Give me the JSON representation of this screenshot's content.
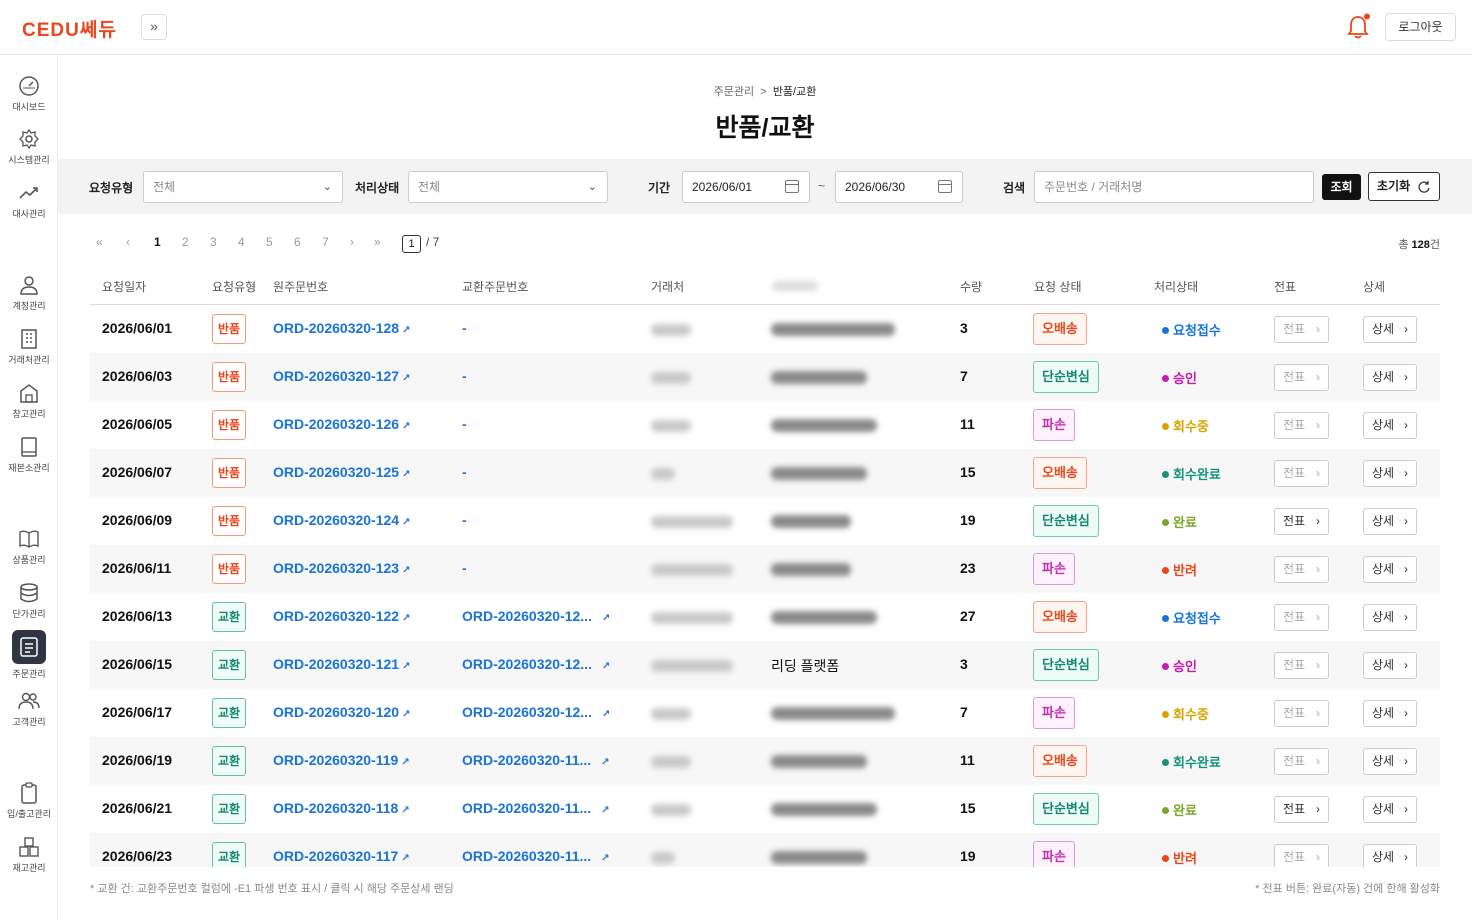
{
  "app": {
    "logo": "CEDU쎄듀",
    "expand_icon": "»",
    "logout_label": "로그아웃"
  },
  "sidebar": {
    "items": [
      {
        "label": "대시보드",
        "icon": "dashboard-icon"
      },
      {
        "label": "시스템관리",
        "icon": "gear-icon"
      },
      {
        "label": "대사관리",
        "icon": "trend-icon"
      },
      {
        "label": "계정관리",
        "icon": "user-icon"
      },
      {
        "label": "거래처관리",
        "icon": "building-icon"
      },
      {
        "label": "창고관리",
        "icon": "warehouse-icon"
      },
      {
        "label": "재본소관리",
        "icon": "book-closed-icon"
      },
      {
        "label": "상품관리",
        "icon": "book-open-icon"
      },
      {
        "label": "단가관리",
        "icon": "database-icon"
      },
      {
        "label": "주문관리",
        "icon": "order-list-icon",
        "active": true
      },
      {
        "label": "고객관리",
        "icon": "users-icon"
      },
      {
        "label": "입/출고관리",
        "icon": "clipboard-icon"
      },
      {
        "label": "재고관리",
        "icon": "boxes-icon"
      }
    ]
  },
  "breadcrumb": {
    "parent": "주문관리",
    "separator": ">",
    "current": "반품/교환"
  },
  "page_title": "반품/교환",
  "filters": {
    "request_type_label": "요청유형",
    "request_type_value": "전체",
    "process_status_label": "처리상태",
    "process_status_value": "전체",
    "period_label": "기간",
    "date_from": "2026/06/01",
    "tilde": "~",
    "date_to": "2026/06/30",
    "search_label": "검색",
    "search_placeholder": "주문번호 / 거래처명",
    "search_button": "조회",
    "reset_button": "초기화"
  },
  "pagination": {
    "first": "«",
    "prev": "‹",
    "pages": [
      "1",
      "2",
      "3",
      "4",
      "5",
      "6",
      "7"
    ],
    "next": "›",
    "last": "»",
    "current_input": "1",
    "total_pages": "/ 7"
  },
  "total": {
    "prefix": "총",
    "count": "128",
    "suffix": "건"
  },
  "columns": [
    "요청일자",
    "요청유형",
    "원주문번호",
    "교환주문번호",
    "거래처",
    "수량",
    "요청 상태",
    "처리상태",
    "전표",
    "상세"
  ],
  "rows": [
    {
      "date": "2026/06/01",
      "type": "반품",
      "order": "ORD-20260320-128",
      "exchange_order": "-",
      "product": "",
      "qty": "3",
      "request_status": "오배송",
      "process_status": "요청접수",
      "slip": "전표",
      "detail": "상세"
    },
    {
      "date": "2026/06/03",
      "type": "반품",
      "order": "ORD-20260320-127",
      "exchange_order": "-",
      "product": "",
      "qty": "7",
      "request_status": "단순변심",
      "process_status": "승인",
      "slip": "전표",
      "detail": "상세"
    },
    {
      "date": "2026/06/05",
      "type": "반품",
      "order": "ORD-20260320-126",
      "exchange_order": "-",
      "product": "",
      "qty": "11",
      "request_status": "파손",
      "process_status": "회수중",
      "slip": "전표",
      "detail": "상세"
    },
    {
      "date": "2026/06/07",
      "type": "반품",
      "order": "ORD-20260320-125",
      "exchange_order": "-",
      "product": "",
      "qty": "15",
      "request_status": "오배송",
      "process_status": "회수완료",
      "slip": "전표",
      "detail": "상세"
    },
    {
      "date": "2026/06/09",
      "type": "반품",
      "order": "ORD-20260320-124",
      "exchange_order": "-",
      "product": "",
      "qty": "19",
      "request_status": "단순변심",
      "process_status": "완료",
      "slip": "전표",
      "detail": "상세"
    },
    {
      "date": "2026/06/11",
      "type": "반품",
      "order": "ORD-20260320-123",
      "exchange_order": "-",
      "product": "",
      "qty": "23",
      "request_status": "파손",
      "process_status": "반려",
      "slip": "전표",
      "detail": "상세"
    },
    {
      "date": "2026/06/13",
      "type": "교환",
      "order": "ORD-20260320-122",
      "exchange_order": "ORD-20260320-12...",
      "product": "",
      "qty": "27",
      "request_status": "오배송",
      "process_status": "요청접수",
      "slip": "전표",
      "detail": "상세"
    },
    {
      "date": "2026/06/15",
      "type": "교환",
      "order": "ORD-20260320-121",
      "exchange_order": "ORD-20260320-12...",
      "product": "리딩 플랫폼",
      "qty": "3",
      "request_status": "단순변심",
      "process_status": "승인",
      "slip": "전표",
      "detail": "상세"
    },
    {
      "date": "2026/06/17",
      "type": "교환",
      "order": "ORD-20260320-120",
      "exchange_order": "ORD-20260320-12...",
      "product": "",
      "qty": "7",
      "request_status": "파손",
      "process_status": "회수중",
      "slip": "전표",
      "detail": "상세"
    },
    {
      "date": "2026/06/19",
      "type": "교환",
      "order": "ORD-20260320-119",
      "exchange_order": "ORD-20260320-11...",
      "product": "",
      "qty": "11",
      "request_status": "오배송",
      "process_status": "회수완료",
      "slip": "전표",
      "detail": "상세"
    },
    {
      "date": "2026/06/21",
      "type": "교환",
      "order": "ORD-20260320-118",
      "exchange_order": "ORD-20260320-11...",
      "product": "",
      "qty": "15",
      "request_status": "단순변심",
      "process_status": "완료",
      "slip": "전표",
      "detail": "상세"
    },
    {
      "date": "2026/06/23",
      "type": "교환",
      "order": "ORD-20260320-117",
      "exchange_order": "ORD-20260320-11...",
      "product": "",
      "qty": "19",
      "request_status": "파손",
      "process_status": "반려",
      "slip": "전표",
      "detail": "상세"
    }
  ],
  "status_colors": {
    "요청접수": "#1a73d6",
    "승인": "#c91aa8",
    "회수중": "#d9a200",
    "회수완료": "#14937a",
    "완료": "#7aa82a",
    "반려": "#e8481c"
  },
  "footnotes": {
    "left": "* 교환 건: 교환주문번호 컬럼에 -E1 파생 번호 표시 / 클릭 시 해당 주문상세 랜딩",
    "right": "* 전표 버튼: 완료(자동) 건에 한해 활성화"
  }
}
